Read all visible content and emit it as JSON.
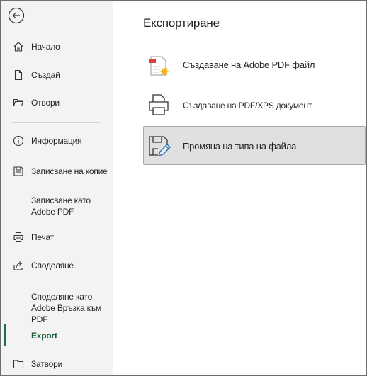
{
  "sidebar": {
    "back_icon": "back-arrow-icon",
    "items": [
      {
        "label": "Начало",
        "icon": "home-icon"
      },
      {
        "label": "Създай",
        "icon": "new-document-icon"
      },
      {
        "label": "Отвори",
        "icon": "folder-open-icon"
      },
      {
        "label": "Информация",
        "icon": "info-icon"
      },
      {
        "label": "Записване на копие",
        "icon": "save-icon"
      },
      {
        "label": "Записване като Adobe PDF",
        "icon": ""
      },
      {
        "label": "Печат",
        "icon": "printer-icon"
      },
      {
        "label": "Споделяне",
        "icon": "share-icon"
      },
      {
        "label": "Споделяне като Adobe Връзка към PDF",
        "icon": ""
      },
      {
        "label": "Export",
        "icon": ""
      },
      {
        "label": "Затвори",
        "icon": "close-folder-icon"
      }
    ],
    "active_item": "Export"
  },
  "main": {
    "title": "Експортиране",
    "options": [
      {
        "label": "Създаване на Adobe PDF файл",
        "icon": "adobe-pdf-icon"
      },
      {
        "label": "Създаване на PDF/XPS документ",
        "icon": "printer-pdf-icon"
      },
      {
        "label": "Промяна на типа на файла",
        "icon": "change-file-type-icon",
        "selected": true
      }
    ]
  },
  "colors": {
    "sidebar_bg": "#f3f3f3",
    "accent_green": "#1e7145",
    "selected_bg": "#e0e0e0"
  }
}
